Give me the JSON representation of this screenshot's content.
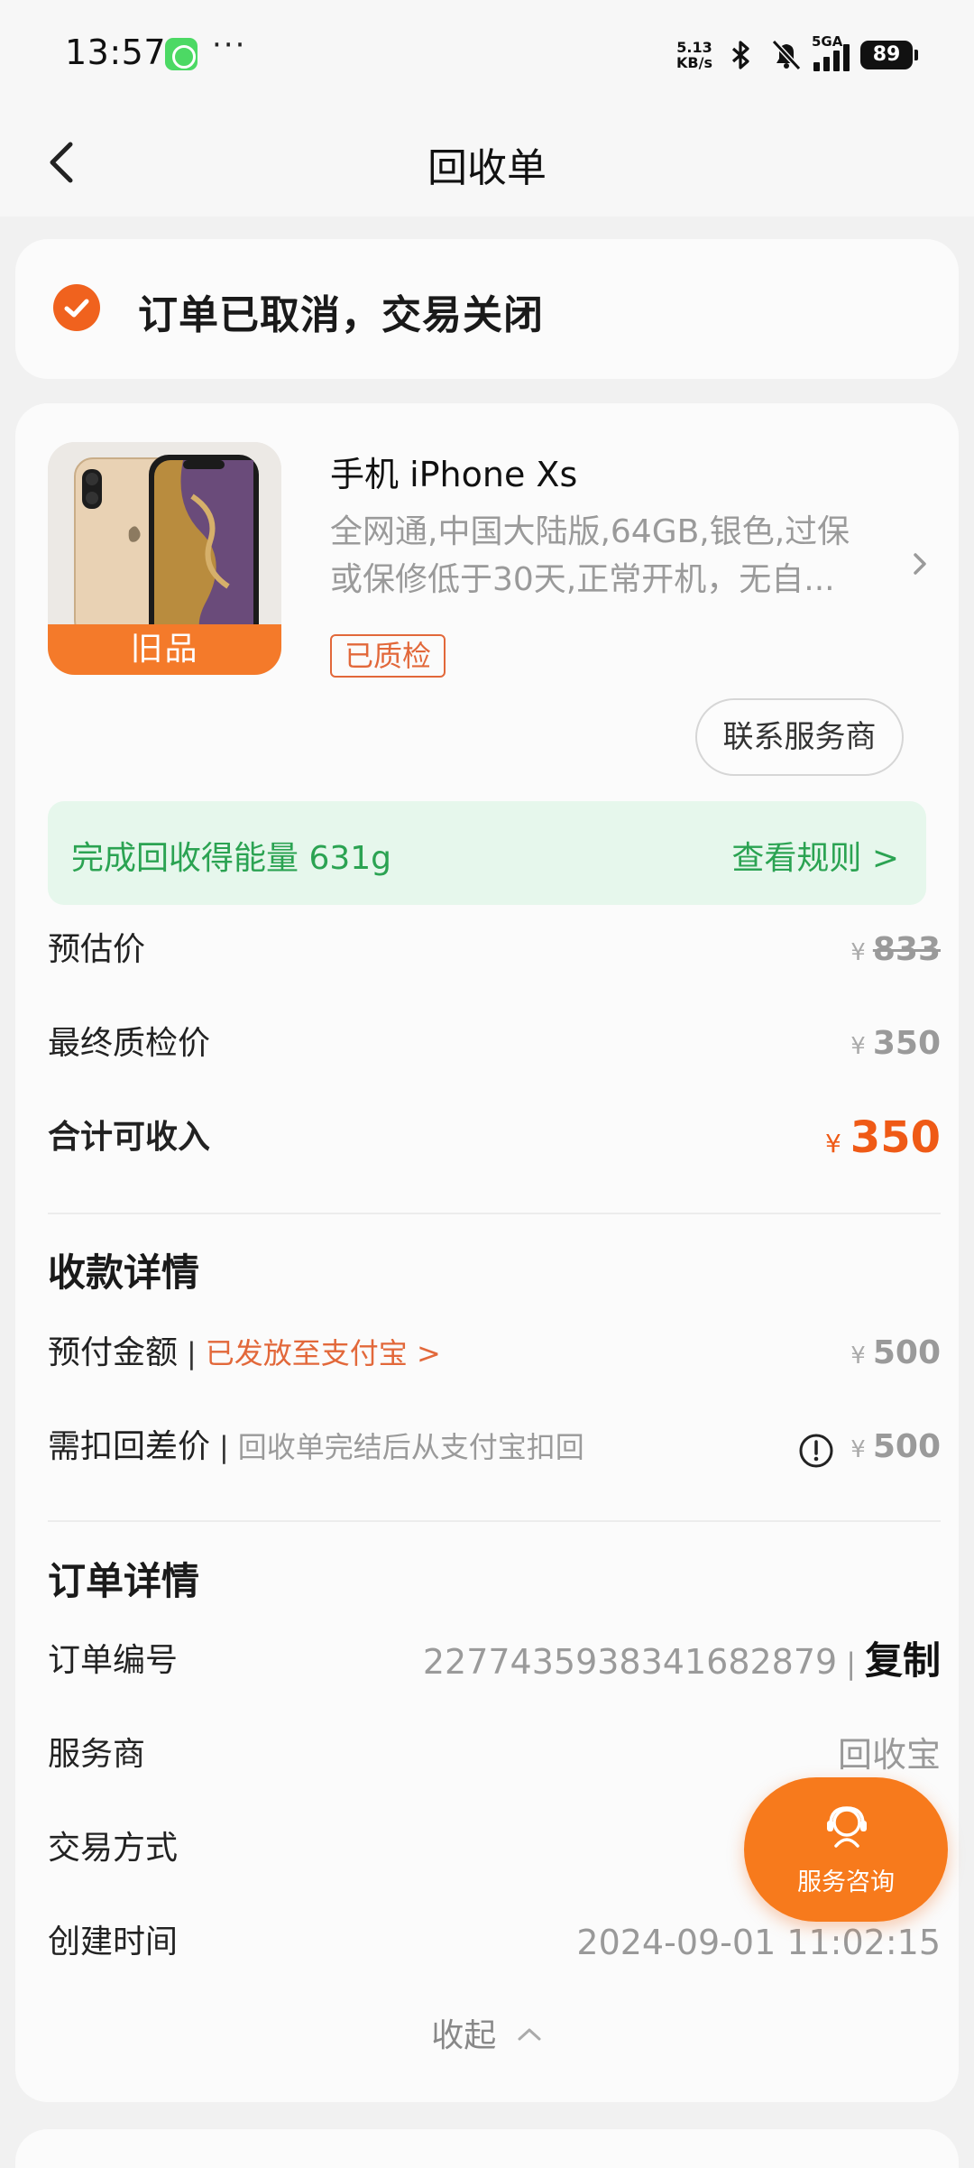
{
  "status_bar": {
    "time": "13:57",
    "speed_value": "5.13",
    "speed_unit": "KB/s",
    "network": "5GA",
    "battery": "89"
  },
  "nav": {
    "title": "回收单"
  },
  "order_status": {
    "text": "订单已取消，交易关闭",
    "accent_color": "#f0621e"
  },
  "product": {
    "condition_tag": "旧品",
    "name": "手机 iPhone Xs",
    "desc_line1": "全网通,中国大陆版,64GB,银色,过保",
    "desc_line2": "或保修低于30天,正常开机，无自...",
    "qc_tag": "已质检",
    "contact_button": "联系服务商"
  },
  "energy": {
    "text": "完成回收得能量 631g",
    "link": "查看规则 >",
    "color": "#2ba352"
  },
  "prices": {
    "estimate_label": "预估价",
    "estimate_currency": "¥",
    "estimate_value": "833",
    "final_label": "最终质检价",
    "final_currency": "¥",
    "final_value": "350",
    "total_label": "合计可收入",
    "total_currency": "¥",
    "total_value": "350"
  },
  "payment": {
    "section_title": "收款详情",
    "prepaid_label": "预付金额",
    "prepaid_note": "已发放至支付宝 >",
    "prepaid_currency": "¥",
    "prepaid_value": "500",
    "deduct_label": "需扣回差价",
    "deduct_note": "回收单完结后从支付宝扣回",
    "deduct_currency": "¥",
    "deduct_value": "500"
  },
  "order": {
    "section_title": "订单详情",
    "number_label": "订单编号",
    "number_value": "2277435938341682879",
    "copy_label": "复制",
    "provider_label": "服务商",
    "provider_value": "回收宝",
    "trade_label": "交易方式",
    "created_label": "创建时间",
    "created_value": "2024-09-01 11:02:15",
    "collapse_label": "收起"
  },
  "fab": {
    "label": "服务咨询",
    "color": "#f77a1c"
  }
}
